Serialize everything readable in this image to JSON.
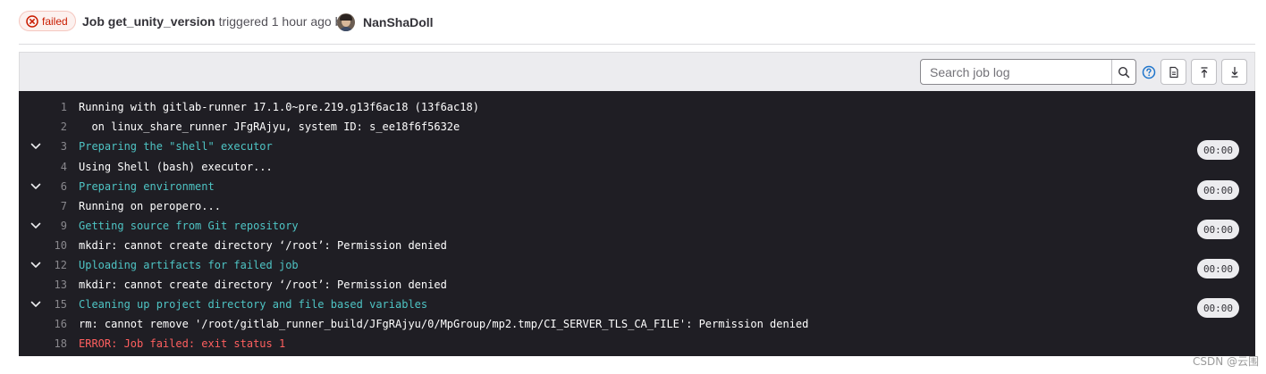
{
  "header": {
    "status": "failed",
    "job_label": "Job get_unity_version",
    "triggered_text": "triggered 1 hour ago by",
    "author": "NanShaDoll"
  },
  "toolbar": {
    "search_placeholder": "Search job log",
    "search_value": "",
    "icons": [
      "search-icon",
      "help-icon",
      "raw-log-icon",
      "scroll-to-top-icon",
      "scroll-to-bottom-icon"
    ]
  },
  "log": {
    "lines": [
      {
        "num": "1",
        "text": "Running with gitlab-runner 17.1.0~pre.219.g13f6ac18 (13f6ac18)",
        "kind": "normal"
      },
      {
        "num": "2",
        "text": "  on linux_share_runner JFgRAjyu, system ID: s_ee18f6f5632e",
        "kind": "normal"
      },
      {
        "num": "3",
        "text": "Preparing the \"shell\" executor",
        "kind": "section",
        "duration": "00:00"
      },
      {
        "num": "4",
        "text": "Using Shell (bash) executor...",
        "kind": "normal"
      },
      {
        "num": "6",
        "text": "Preparing environment",
        "kind": "section",
        "duration": "00:00"
      },
      {
        "num": "7",
        "text": "Running on peropero...",
        "kind": "normal"
      },
      {
        "num": "9",
        "text": "Getting source from Git repository",
        "kind": "section",
        "duration": "00:00"
      },
      {
        "num": "10",
        "text": "mkdir: cannot create directory ‘/root’: Permission denied",
        "kind": "normal"
      },
      {
        "num": "12",
        "text": "Uploading artifacts for failed job",
        "kind": "section",
        "duration": "00:00"
      },
      {
        "num": "13",
        "text": "mkdir: cannot create directory ‘/root’: Permission denied",
        "kind": "normal"
      },
      {
        "num": "15",
        "text": "Cleaning up project directory and file based variables",
        "kind": "section",
        "duration": "00:00"
      },
      {
        "num": "16",
        "text": "rm: cannot remove '/root/gitlab_runner_build/JFgRAjyu/0/MpGroup/mp2.tmp/CI_SERVER_TLS_CA_FILE': Permission denied",
        "kind": "normal"
      },
      {
        "num": "18",
        "text": "ERROR: Job failed: exit status 1",
        "kind": "error"
      }
    ]
  },
  "colors": {
    "section": "#4ec4c4",
    "error": "#ff5f5f",
    "log_bg": "#1f1e24",
    "failed": "#c91c00"
  },
  "watermark": "CSDN @云围"
}
